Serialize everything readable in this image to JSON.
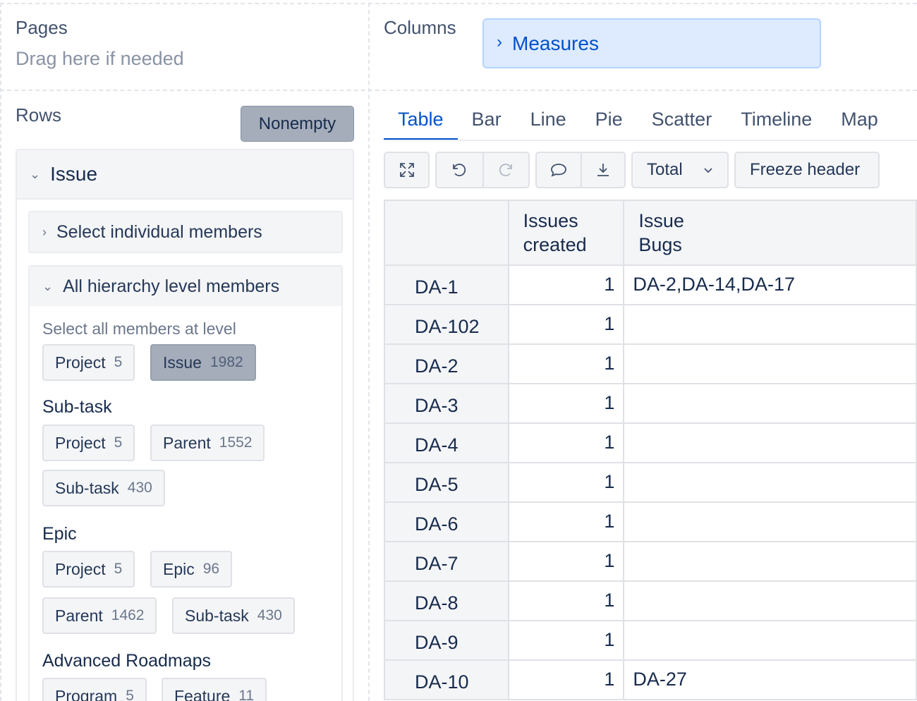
{
  "pages": {
    "title": "Pages",
    "hint": "Drag here if needed"
  },
  "columns": {
    "title": "Columns",
    "measures_label": "Measures"
  },
  "rows": {
    "title": "Rows",
    "nonempty_label": "Nonempty",
    "dimension": "Issue",
    "select_individual": "Select individual members",
    "all_levels": "All hierarchy level members",
    "select_all_hint": "Select all members at level",
    "issue_levels": [
      {
        "label": "Project",
        "count": "5"
      },
      {
        "label": "Issue",
        "count": "1982"
      }
    ],
    "subtask": {
      "title": "Sub-task",
      "levels": [
        {
          "label": "Project",
          "count": "5"
        },
        {
          "label": "Parent",
          "count": "1552"
        },
        {
          "label": "Sub-task",
          "count": "430"
        }
      ]
    },
    "epic": {
      "title": "Epic",
      "levels": [
        {
          "label": "Project",
          "count": "5"
        },
        {
          "label": "Epic",
          "count": "96"
        },
        {
          "label": "Parent",
          "count": "1462"
        },
        {
          "label": "Sub-task",
          "count": "430"
        }
      ]
    },
    "roadmaps": {
      "title": "Advanced Roadmaps",
      "levels": [
        {
          "label": "Program",
          "count": "5"
        },
        {
          "label": "Feature",
          "count": "11"
        }
      ]
    }
  },
  "view_tabs": [
    "Table",
    "Bar",
    "Line",
    "Pie",
    "Scatter",
    "Timeline",
    "Map"
  ],
  "active_tab": "Table",
  "toolbar": {
    "total_label": "Total",
    "freeze_label": "Freeze header",
    "icons": [
      "expand-icon",
      "undo-icon",
      "redo-icon",
      "comment-icon",
      "download-icon",
      "chevron-down-icon"
    ]
  },
  "table": {
    "headers": [
      "",
      "Issues created",
      "Issue Bugs"
    ],
    "rows": [
      {
        "name": "DA-1",
        "created": "1",
        "bugs": "DA-2,DA-14,DA-17"
      },
      {
        "name": "DA-102",
        "created": "1",
        "bugs": ""
      },
      {
        "name": "DA-2",
        "created": "1",
        "bugs": ""
      },
      {
        "name": "DA-3",
        "created": "1",
        "bugs": ""
      },
      {
        "name": "DA-4",
        "created": "1",
        "bugs": ""
      },
      {
        "name": "DA-5",
        "created": "1",
        "bugs": ""
      },
      {
        "name": "DA-6",
        "created": "1",
        "bugs": ""
      },
      {
        "name": "DA-7",
        "created": "1",
        "bugs": ""
      },
      {
        "name": "DA-8",
        "created": "1",
        "bugs": ""
      },
      {
        "name": "DA-9",
        "created": "1",
        "bugs": ""
      },
      {
        "name": "DA-10",
        "created": "1",
        "bugs": "DA-27"
      }
    ]
  }
}
